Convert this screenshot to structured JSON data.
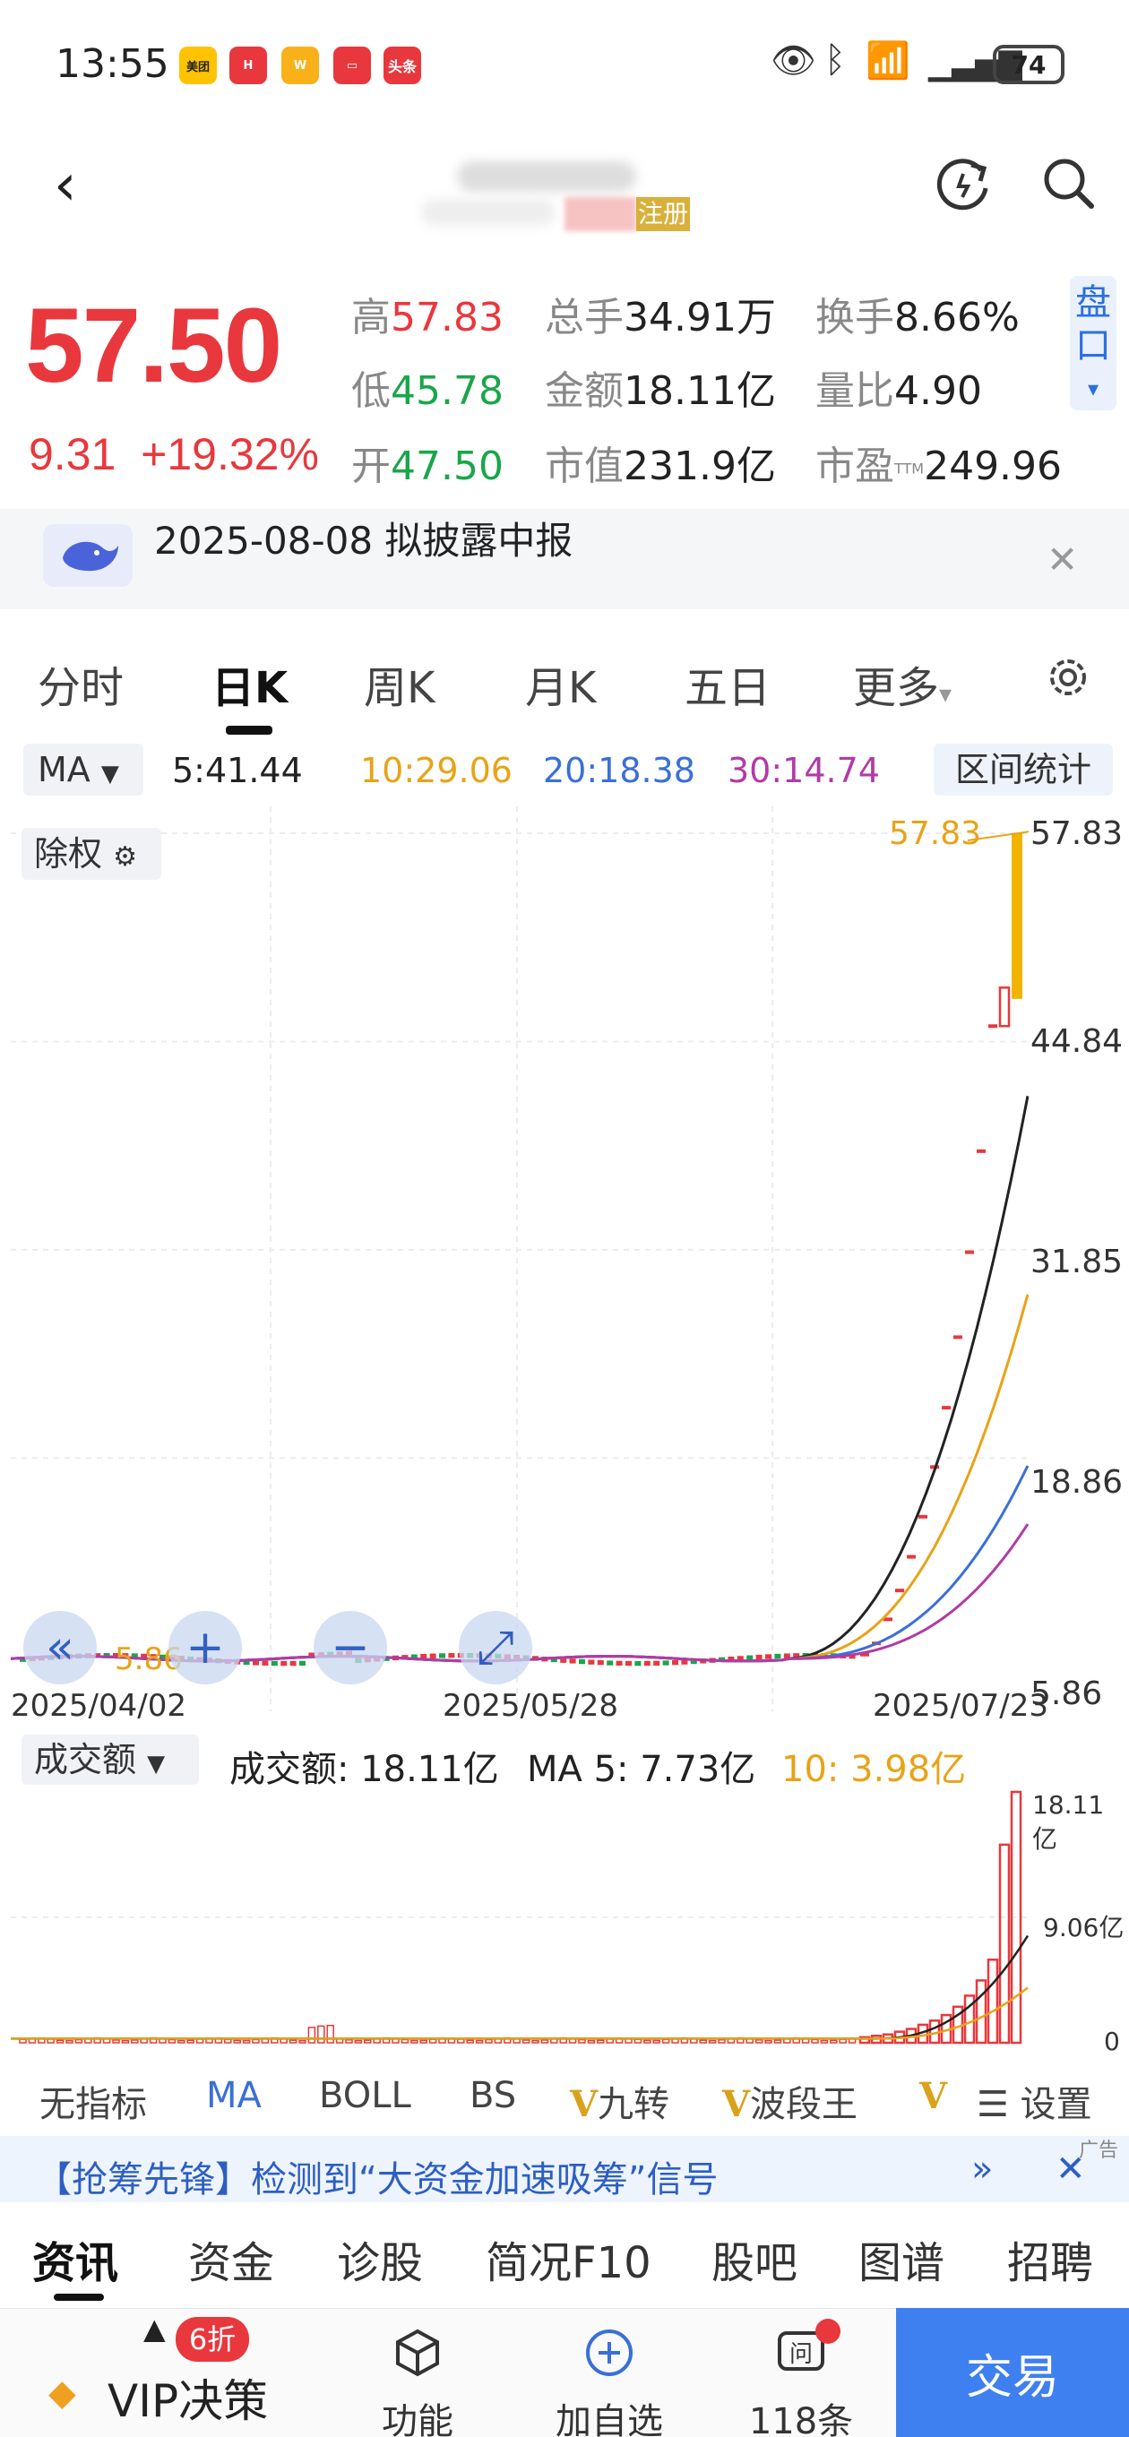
{
  "status_bar": {
    "time": "13:55",
    "battery": "74",
    "apps": [
      {
        "name": "美团",
        "color": "#ffc300"
      },
      {
        "name": "HUAWEI",
        "color": "#e8383d"
      },
      {
        "name": "weibo",
        "color": "#f9b11a"
      },
      {
        "name": "red",
        "color": "#e8383d"
      },
      {
        "name": "头条",
        "color": "#e8383d"
      }
    ]
  },
  "quote": {
    "price": "57.50",
    "change": "9.31",
    "change_pct": "+19.32%",
    "high_label": "高",
    "high": "57.83",
    "low_label": "低",
    "low": "45.78",
    "open_label": "开",
    "open": "47.50",
    "vol_label": "总手",
    "vol": "34.91万",
    "amount_label": "金额",
    "amount": "18.11亿",
    "mcap_label": "市值",
    "mcap": "231.9亿",
    "turnover_label": "换手",
    "turnover": "8.66%",
    "vol_ratio_label": "量比",
    "vol_ratio": "4.90",
    "pe_label": "市盈",
    "pe_sup": "TTM",
    "pe": "249.96",
    "pankou": "盘口",
    "tag": "注册"
  },
  "notice": {
    "text": "2025-08-08 拟披露中报"
  },
  "period_tabs": [
    "分时",
    "日K",
    "周K",
    "月K",
    "五日",
    "更多"
  ],
  "ma": {
    "selector": "MA",
    "ma5": "5:41.44",
    "ma10": "10:29.06",
    "ma20": "20:18.38",
    "ma30": "30:14.74",
    "range_button": "区间统计",
    "colors": {
      "ma5": "#222222",
      "ma10": "#e8a317",
      "ma20": "#3a6fd8",
      "ma30": "#b23aa8"
    }
  },
  "chart": {
    "adjust_button": "除权",
    "max_marker": "57.83",
    "min_marker": "5.86",
    "y_labels": [
      "57.83",
      "44.84",
      "31.85",
      "18.86",
      "5.86"
    ],
    "x_labels": [
      "2025/04/02",
      "2025/05/28",
      "2025/07/23"
    ],
    "zoom_icons": [
      "«",
      "+",
      "−",
      "⤢"
    ]
  },
  "chart_data": {
    "type": "line",
    "title": "",
    "ylim": [
      5.86,
      57.83
    ],
    "x": [
      "2025/04/02",
      "2025/05/28",
      "2025/07/23"
    ],
    "candles_close_recent": [
      6.6,
      7.3,
      8.8,
      10.6,
      12.7,
      15.2,
      18.3,
      22.0,
      26.4,
      31.7,
      38.0,
      45.8,
      48.2,
      57.5
    ],
    "series": [
      {
        "name": "MA5",
        "latest": 41.44
      },
      {
        "name": "MA10",
        "latest": 29.06
      },
      {
        "name": "MA20",
        "latest": 18.38
      },
      {
        "name": "MA30",
        "latest": 14.74
      }
    ],
    "volume": {
      "latest": "18.11亿",
      "ma5": "7.73亿",
      "ma10": "3.98亿",
      "ylabels": [
        "18.11亿",
        "9.06亿",
        "0"
      ]
    }
  },
  "volume_bar": {
    "selector": "成交额",
    "amount": "成交额: 18.11亿",
    "ma5": "MA 5: 7.73亿",
    "ma10": "10: 3.98亿"
  },
  "indicator_tabs": [
    "无指标",
    "MA",
    "BOLL",
    "BS",
    "九转",
    "波段王",
    "设置"
  ],
  "ad": {
    "text": "【抢筹先锋】检测到“大资金加速吸筹”信号",
    "tag": "广告"
  },
  "bottom_tabs": [
    "资讯",
    "资金",
    "诊股",
    "简况F10",
    "股吧",
    "图谱",
    "招聘"
  ],
  "toolbar": {
    "vip_badge": "6折",
    "vip": "VIP决策",
    "func": "功能",
    "add": "加自选",
    "ask": "118条",
    "trade": "交易"
  }
}
